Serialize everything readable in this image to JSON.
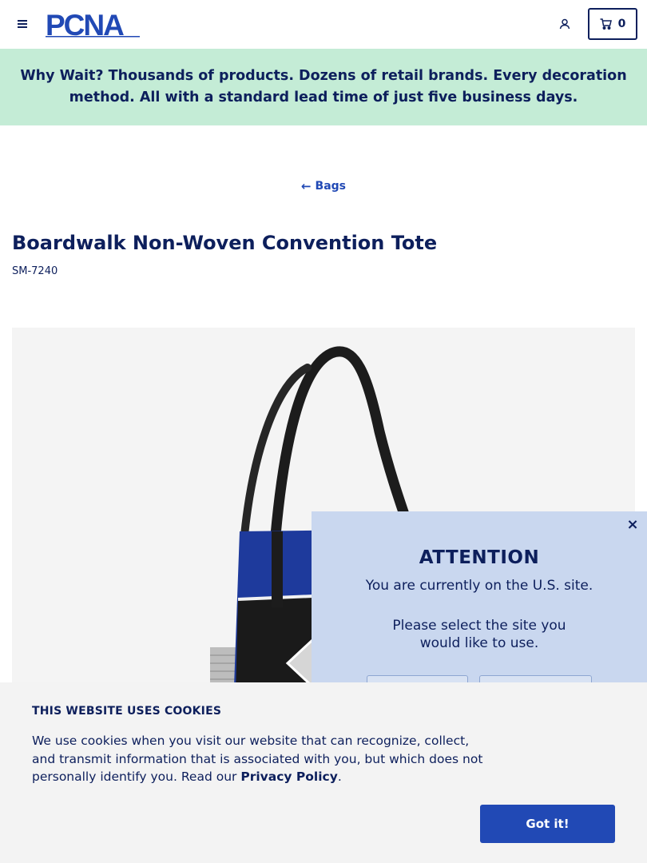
{
  "header": {
    "logo_text": "PCNA",
    "cart_count": "0"
  },
  "banner": {
    "text": "Why Wait? Thousands of products. Dozens of retail brands. Every decoration method. All with a standard lead time of just five business days."
  },
  "breadcrumb": {
    "back_label": "Bags"
  },
  "product": {
    "title": "Boardwalk Non-Woven Convention Tote",
    "sku": "SM-7240"
  },
  "attention_popup": {
    "close_label": "×",
    "title": "ATTENTION",
    "current_site": "You are currently on the U.S. site.",
    "prompt": "Please select the site you would like to use."
  },
  "cookie_banner": {
    "title": "THIS WEBSITE USES COOKIES",
    "text_before_link": "We use cookies when you visit our website that can recognize, collect, and transmit information that is associated with you, but which does not personally identify you. Read our ",
    "link_label": "Privacy Policy",
    "text_after_link": ".",
    "accept_label": "Got it!"
  },
  "colors": {
    "brand_navy": "#0d1f5c",
    "accent_blue": "#2149b5",
    "banner_green": "#c4ecd6",
    "popup_blue": "#c9d7ef",
    "tote_blue": "#1e3a9c"
  }
}
